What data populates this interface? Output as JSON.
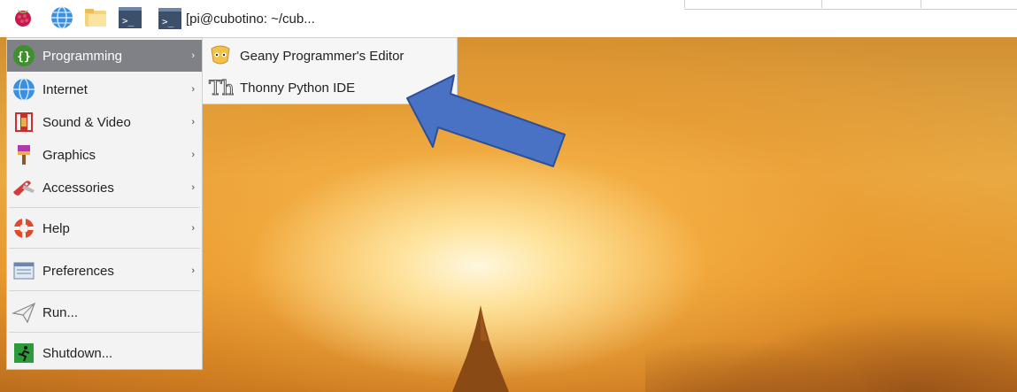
{
  "panel": {
    "taskbar_window_title": "[pi@cubotino: ~/cub..."
  },
  "menu": {
    "items": [
      {
        "label": "Programming",
        "has_submenu": true,
        "active": true
      },
      {
        "label": "Internet",
        "has_submenu": true
      },
      {
        "label": "Sound & Video",
        "has_submenu": true
      },
      {
        "label": "Graphics",
        "has_submenu": true
      },
      {
        "label": "Accessories",
        "has_submenu": true
      },
      {
        "label": "Help",
        "has_submenu": true
      },
      {
        "label": "Preferences",
        "has_submenu": true
      },
      {
        "label": "Run...",
        "has_submenu": false
      },
      {
        "label": "Shutdown...",
        "has_submenu": false
      }
    ],
    "submenu_arrow": "›"
  },
  "submenu": {
    "items": [
      {
        "label": "Geany Programmer's Editor",
        "icon": "geany-icon"
      },
      {
        "label": "Thonny Python IDE",
        "icon": "thonny-icon"
      }
    ]
  },
  "colors": {
    "active_item": "#7f8186",
    "annotation_arrow": "#4a72c4"
  }
}
